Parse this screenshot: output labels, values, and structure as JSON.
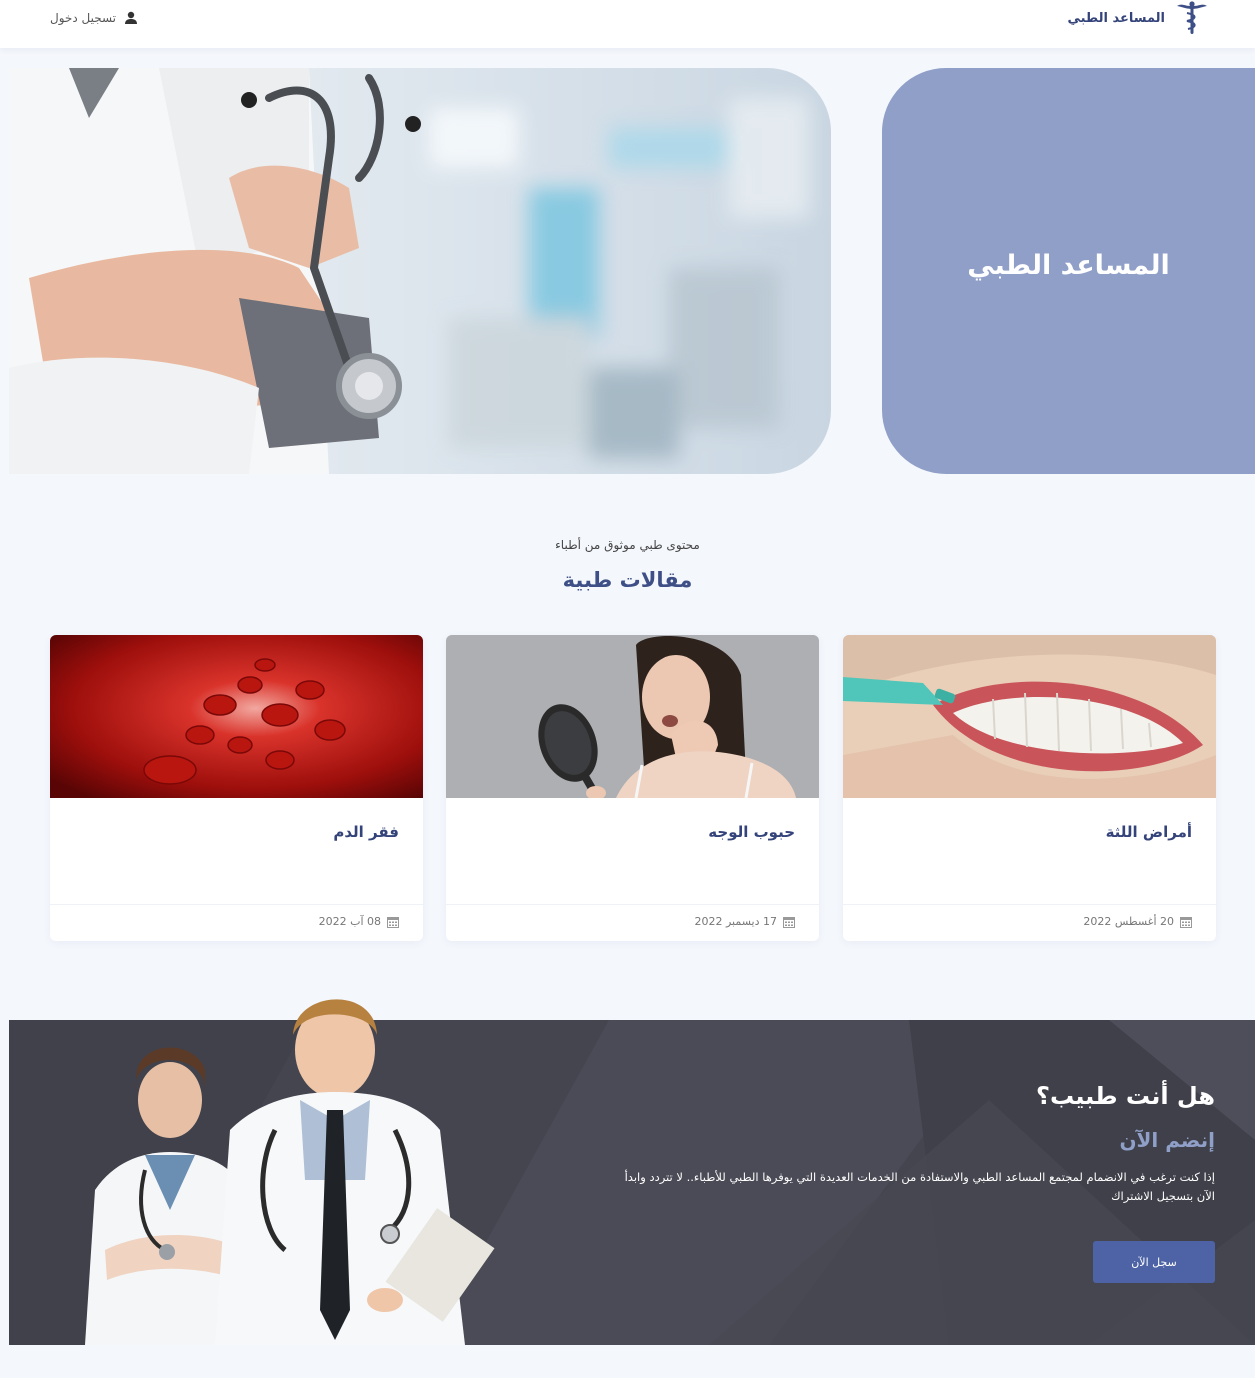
{
  "header": {
    "brand_name": "المساعد الطبي",
    "brand_icon": "caduceus-logo-icon",
    "login_label": "تسجيل دخول",
    "login_icon": "user-icon"
  },
  "hero": {
    "title": "المساعد الطبي",
    "panel_color": "#8f9fc8"
  },
  "articles": {
    "subtitle": "محتوى طبي موثوق من أطباء",
    "title": "مقالات طبية",
    "cards": [
      {
        "title": "أمراض اللثة",
        "date": "20 أغسطس 2022",
        "image": "teeth-flossing-image"
      },
      {
        "title": "حبوب الوجه",
        "date": "17 ديسمبر 2022",
        "image": "woman-mirror-acne-image"
      },
      {
        "title": "فقر الدم",
        "date": "08 آب 2022",
        "image": "red-blood-cells-image"
      }
    ]
  },
  "cta": {
    "heading": "هل أنت طبيب؟",
    "subheading": "إنضم الآن",
    "text": "إذا كنت ترغب في الانضمام لمجتمع المساعد الطبي والاستفادة من الخدمات العديدة التي يوفرها الطبي للأطباء.. لا تتردد وابدأ الآن بتسجيل الاشتراك",
    "button_label": "سجل الآن",
    "accent_color": "#4d63a6",
    "background_color": "#44454f"
  }
}
